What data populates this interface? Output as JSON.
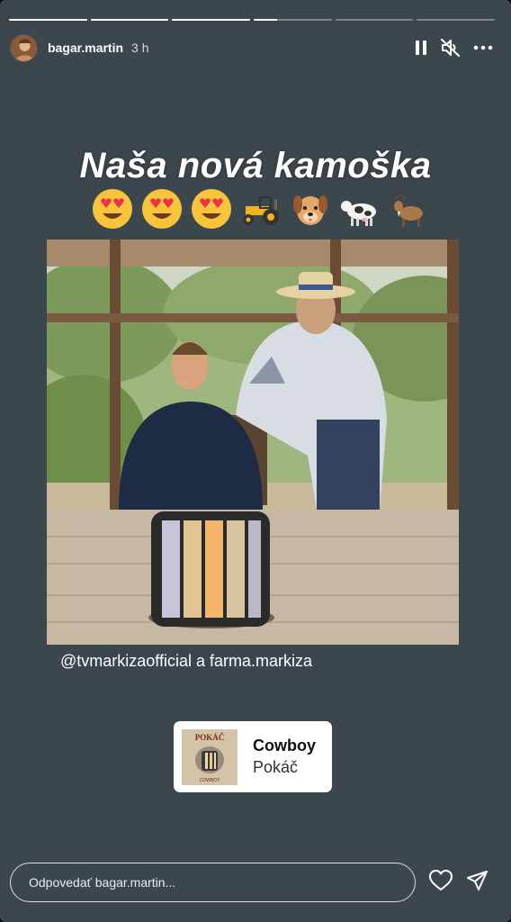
{
  "progress": [
    1.0,
    1.0,
    1.0,
    0.3,
    0.0,
    0.0
  ],
  "header": {
    "username": "bagar.martin",
    "time_ago": "3 h",
    "icons": [
      "pause-icon",
      "muted-speaker-icon",
      "more-options-icon"
    ]
  },
  "story": {
    "headline": "Naša nová kamoška",
    "emojis": [
      "heart-eyes",
      "heart-eyes",
      "heart-eyes",
      "tractor",
      "dog-face",
      "cow",
      "goat"
    ],
    "caption": "@tvmarkizaofficial a farma.markiza",
    "background_color": "#3b464d"
  },
  "music": {
    "album_text": "POKÁČ",
    "album_subtext": "COWBOY",
    "song": "Cowboy",
    "artist": "Pokáč"
  },
  "reply": {
    "placeholder": "Odpovedať bagar.martin..."
  }
}
